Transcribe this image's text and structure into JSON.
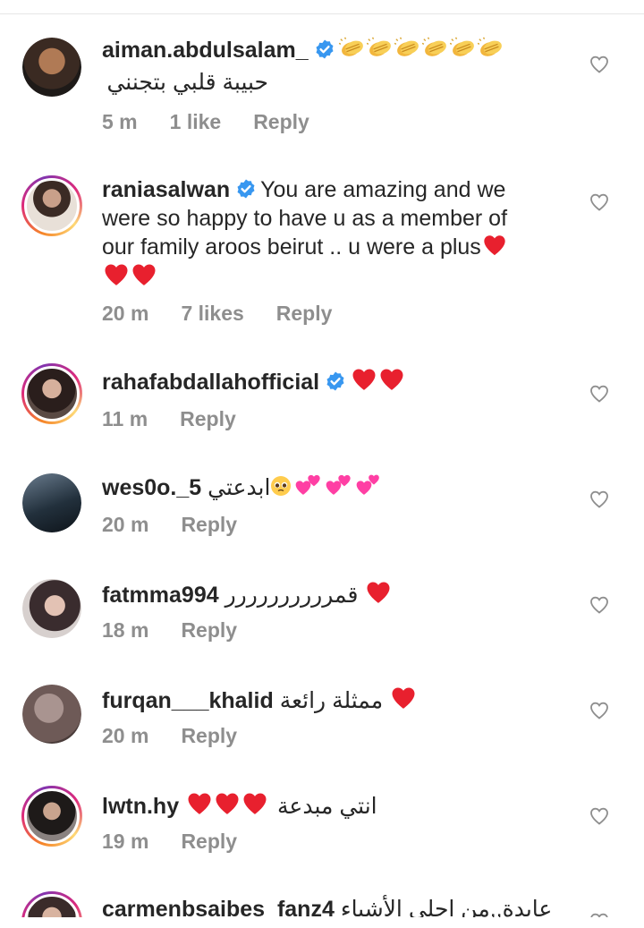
{
  "comments": [
    {
      "username": "aiman.abdulsalam_",
      "verified": true,
      "text_ar": "حبيبة قلبي بتجنني",
      "emoji_icon": "clapping-hands",
      "time": "5 m",
      "likes": "1 like",
      "reply": "Reply"
    },
    {
      "username": "raniasalwan",
      "verified": true,
      "text_1": "You are amazing and we",
      "text_2": "were so happy to have u as a member of",
      "text_3": "our family aroos beirut .. u were a plus",
      "emoji_icon": "red-heart",
      "time": "20 m",
      "likes": "7 likes",
      "reply": "Reply"
    },
    {
      "username": "rahafabdallahofficial",
      "verified": true,
      "emoji_icon": "red-heart",
      "time": "11 m",
      "reply": "Reply"
    },
    {
      "username": "wes0o._5",
      "verified": false,
      "text_ar": "ابدعتي",
      "emoji_icon": "pleading-face-and-two-hearts",
      "time": "20 m",
      "reply": "Reply"
    },
    {
      "username": "fatmma994",
      "verified": false,
      "text_ar": "قمرررررررررر",
      "emoji_icon": "red-heart",
      "time": "18 m",
      "reply": "Reply"
    },
    {
      "username": "furqan___khalid",
      "verified": false,
      "text_ar": "ممثلة رائعة",
      "emoji_icon": "red-heart",
      "time": "20 m",
      "reply": "Reply"
    },
    {
      "username": "lwtn.hy",
      "verified": false,
      "text_ar": "انتي مبدعة",
      "emoji_icon": "red-heart",
      "time": "19 m",
      "reply": "Reply"
    },
    {
      "username": "carmenbsaibes_fanz4",
      "verified": false,
      "text_ar": "عايدة,,من احلى الأشياء",
      "time": ""
    }
  ],
  "colors": {
    "text": "#262626",
    "meta": "#8e8e8e",
    "verified": "#3897f0",
    "heart": "#e8202e"
  }
}
